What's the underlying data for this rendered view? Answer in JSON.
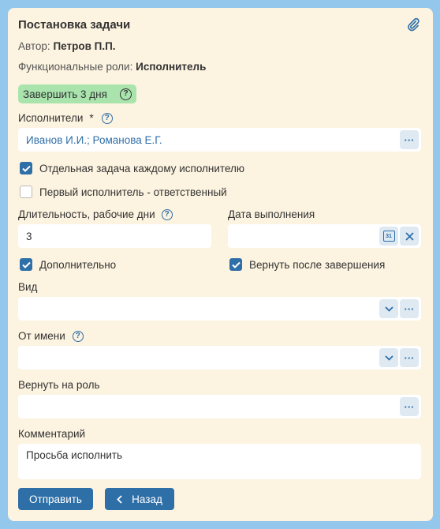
{
  "title": "Постановка задачи",
  "author": {
    "label": "Автор:",
    "value": "Петров П.П."
  },
  "roles": {
    "label": "Функциональные роли:",
    "value": "Исполнитель"
  },
  "deadline_badge": "Завершить 3 дня",
  "executors": {
    "label": "Исполнители",
    "required": "*",
    "value": "Иванов И.И.; Романова Е.Г."
  },
  "checkboxes": {
    "separate_task": {
      "label": "Отдельная задача каждому исполнителю",
      "checked": true
    },
    "first_responsible": {
      "label": "Первый исполнитель - ответственный",
      "checked": false
    },
    "additional": {
      "label": "Дополнительно",
      "checked": true
    },
    "return_after": {
      "label": "Вернуть после завершения",
      "checked": true
    }
  },
  "duration": {
    "label": "Длительность, рабочие дни",
    "value": "3"
  },
  "due_date": {
    "label": "Дата выполнения",
    "value": "",
    "calendar_text": "31"
  },
  "kind": {
    "label": "Вид",
    "value": ""
  },
  "on_behalf": {
    "label": "От имени",
    "value": ""
  },
  "return_role": {
    "label": "Вернуть на роль",
    "value": ""
  },
  "comment": {
    "label": "Комментарий",
    "value": "Просьба исполнить"
  },
  "buttons": {
    "send": "Отправить",
    "back": "Назад"
  },
  "ellipsis": "···",
  "help_glyph": "?",
  "colors": {
    "accent": "#2f6fa8",
    "badge": "#a9e4ad",
    "card": "#fcf3e0",
    "page": "#94c7ec"
  }
}
